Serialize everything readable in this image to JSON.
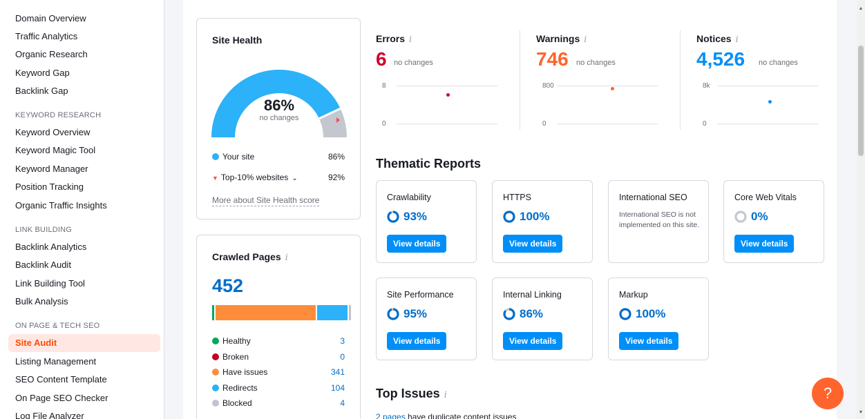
{
  "sidebar": {
    "items_top": [
      "Domain Overview",
      "Traffic Analytics",
      "Organic Research",
      "Keyword Gap",
      "Backlink Gap"
    ],
    "section_keyword": "KEYWORD RESEARCH",
    "items_keyword": [
      "Keyword Overview",
      "Keyword Magic Tool",
      "Keyword Manager",
      "Position Tracking",
      "Organic Traffic Insights"
    ],
    "section_link": "LINK BUILDING",
    "items_link": [
      "Backlink Analytics",
      "Backlink Audit",
      "Link Building Tool",
      "Bulk Analysis"
    ],
    "section_onpage": "ON PAGE & TECH SEO",
    "items_onpage": [
      "Site Audit",
      "Listing Management",
      "SEO Content Template",
      "On Page SEO Checker",
      "Log File Analyzer"
    ],
    "active": "Site Audit"
  },
  "site_health": {
    "title": "Site Health",
    "score": "86%",
    "score_value": 86,
    "sub": "no changes",
    "legend": [
      {
        "label": "Your site",
        "value": "86%"
      },
      {
        "label": "Top-10% websites",
        "value": "92%"
      }
    ],
    "more_link": "More about Site Health score"
  },
  "crawled": {
    "title": "Crawled Pages",
    "info": "i",
    "total": "452",
    "rows": [
      {
        "label": "Healthy",
        "value": "3",
        "color": "#00a85a",
        "count": 3
      },
      {
        "label": "Broken",
        "value": "0",
        "color": "#c00020",
        "count": 0
      },
      {
        "label": "Have issues",
        "value": "341",
        "color": "#ff8c3a",
        "count": 341
      },
      {
        "label": "Redirects",
        "value": "104",
        "color": "#2bb2f8",
        "count": 104
      },
      {
        "label": "Blocked",
        "value": "4",
        "color": "#c2c4cd",
        "count": 4
      }
    ]
  },
  "metrics": [
    {
      "title": "Errors",
      "value": "6",
      "sub": "no changes",
      "color": "#d1002f",
      "ymax": "8",
      "ymin": "0"
    },
    {
      "title": "Warnings",
      "value": "746",
      "sub": "no changes",
      "color": "#ff642d",
      "ymax": "800",
      "ymin": "0"
    },
    {
      "title": "Notices",
      "value": "4,526",
      "sub": "no changes",
      "color": "#008ff8",
      "ymax": "8k",
      "ymin": "0"
    }
  ],
  "thematic": {
    "title": "Thematic Reports",
    "cards": [
      {
        "name": "Crawlability",
        "pct": "93%",
        "btn": "View details"
      },
      {
        "name": "HTTPS",
        "pct": "100%",
        "btn": "View details"
      },
      {
        "name": "International SEO",
        "note": "International SEO is not implemented on this site."
      },
      {
        "name": "Core Web Vitals",
        "pct": "0%",
        "btn": "View details"
      },
      {
        "name": "Site Performance",
        "pct": "95%",
        "btn": "View details"
      },
      {
        "name": "Internal Linking",
        "pct": "86%",
        "btn": "View details"
      },
      {
        "name": "Markup",
        "pct": "100%",
        "btn": "View details"
      }
    ]
  },
  "top_issues": {
    "title": "Top Issues",
    "first_link": "2 pages",
    "first_text": "have duplicate content issues"
  },
  "help_label": "?",
  "colors": {
    "accent_blue": "#008ff8",
    "accent_orange": "#ff642d",
    "error_red": "#d1002f"
  }
}
